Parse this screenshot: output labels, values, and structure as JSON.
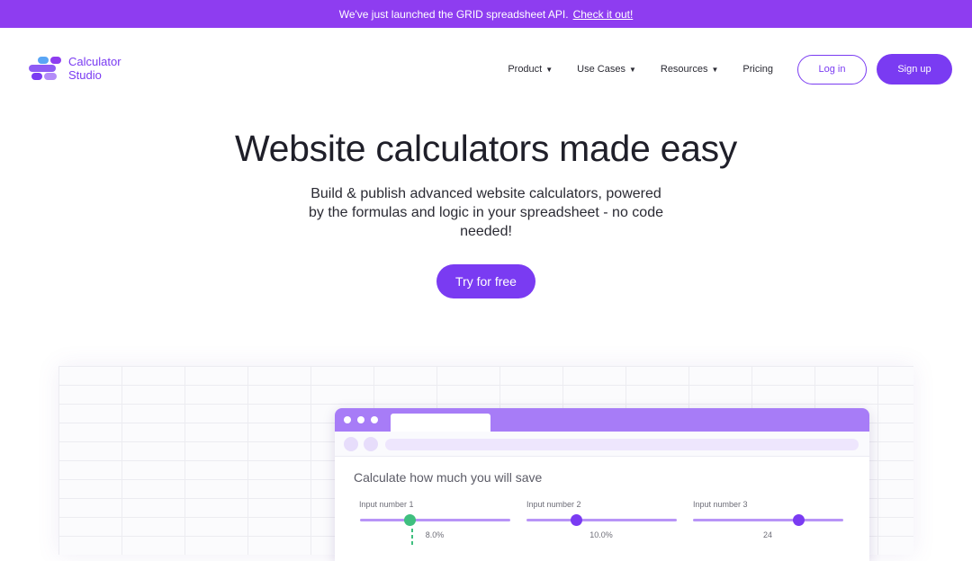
{
  "announcement": {
    "text": "We've just launched the GRID spreadsheet API.",
    "link": "Check it out!"
  },
  "logo": {
    "line1": "Calculator",
    "line2": "Studio",
    "icon": "calculator-studio-logo-icon"
  },
  "nav": {
    "items": [
      {
        "label": "Product",
        "dropdown": true
      },
      {
        "label": "Use Cases",
        "dropdown": true
      },
      {
        "label": "Resources",
        "dropdown": true
      },
      {
        "label": "Pricing",
        "dropdown": false
      }
    ],
    "caret": "▼",
    "login": "Log in",
    "signup": "Sign up"
  },
  "hero": {
    "title": "Website calculators made easy",
    "subtitle": "Build & publish advanced website calculators, powered by the formulas and logic in your spreadsheet - no code needed!",
    "cta": "Try for free"
  },
  "preview": {
    "calc_title": "Calculate how much you will save",
    "inputs": [
      {
        "label": "Input number 1",
        "value": "8.0%",
        "knob_color": "#3fbf7f"
      },
      {
        "label": "Input number 2",
        "value": "10.0%",
        "knob_color": "#7a3bf2"
      },
      {
        "label": "Input number 3",
        "value": "24",
        "knob_color": "#7a3bf2"
      }
    ]
  },
  "colors": {
    "brand": "#7a3bf2",
    "banner": "#8e3df0",
    "browser_header": "#a77cf7",
    "slider_track": "#b894f7",
    "green_accent": "#3fbf7f"
  }
}
